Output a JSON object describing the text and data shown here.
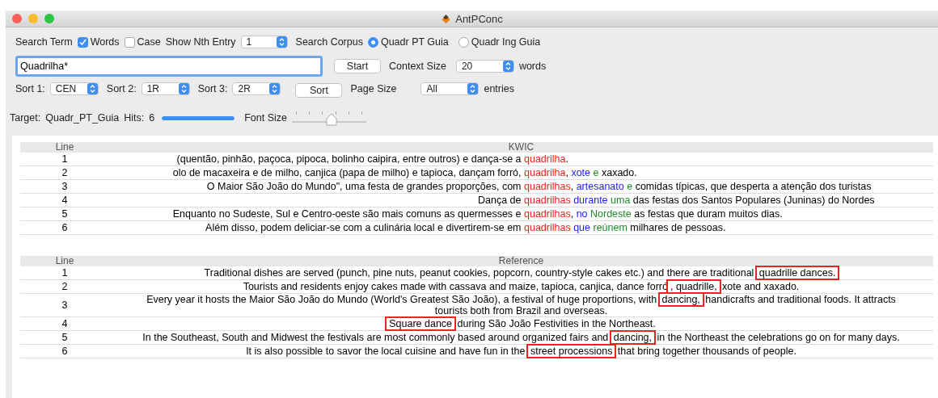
{
  "window": {
    "title": "AntPConc"
  },
  "search": {
    "label": "Search Term",
    "options": [
      {
        "label": "Words",
        "checked": true
      },
      {
        "label": "Case",
        "checked": false
      }
    ],
    "nth_label": "Show Nth Entry",
    "nth_value": "1",
    "corpus_label": "Search Corpus",
    "corpora": [
      {
        "label": "Quadr PT Guia",
        "selected": true
      },
      {
        "label": "Quadr Ing Guia",
        "selected": false
      }
    ],
    "term": "Quadrilha*",
    "start": "Start",
    "context_label": "Context Size",
    "context_value": "20",
    "context_unit": "words"
  },
  "sort": {
    "keys": [
      {
        "label": "Sort 1:",
        "value": "CEN"
      },
      {
        "label": "Sort 2:",
        "value": "1R"
      },
      {
        "label": "Sort 3:",
        "value": "2R"
      }
    ],
    "button": "Sort",
    "page_label": "Page Size",
    "page_value": "All",
    "page_unit": "entries"
  },
  "status": {
    "target_label": "Target:",
    "target": "Quadr_PT_Guia",
    "hits_label": "Hits:",
    "hits": "6",
    "hits_bar": {
      "level": 1
    },
    "font_label": "Font Size",
    "font_slider": {
      "level": 0.53
    }
  },
  "tables": [
    {
      "kind": "kwic",
      "columns": [
        "Line",
        "KWIC"
      ],
      "rows": [
        {
          "line": "1",
          "left": "(quentão, pinhão, paçoca, pipoca, bolinho caipira, entre outros) e dança-se a ",
          "segments": [
            {
              "text": "quadrilha",
              "kind": "center"
            },
            {
              "text": ".",
              "kind": "plain"
            }
          ]
        },
        {
          "line": "2",
          "left": "olo de macaxeira e de milho, canjica (papa de milho) e tapioca, dançam forró, ",
          "segments": [
            {
              "text": "quadrilha",
              "kind": "center"
            },
            {
              "text": ", ",
              "kind": "plain"
            },
            {
              "text": "xote",
              "kind": "first"
            },
            {
              "text": " e",
              "kind": "second"
            },
            {
              "text": " xaxado.",
              "kind": "plain"
            }
          ]
        },
        {
          "line": "3",
          "left": "O Maior São João do Mundo\", uma festa de grandes proporções, com ",
          "segments": [
            {
              "text": "quadrilhas",
              "kind": "center"
            },
            {
              "text": ", ",
              "kind": "plain"
            },
            {
              "text": "artesanato",
              "kind": "first"
            },
            {
              "text": " e",
              "kind": "second"
            },
            {
              "text": " comidas típicas, que desperta a atenção dos turistas",
              "kind": "plain"
            }
          ]
        },
        {
          "line": "4",
          "left": "Dança de ",
          "segments": [
            {
              "text": "quadrilhas",
              "kind": "center"
            },
            {
              "text": " durante",
              "kind": "first"
            },
            {
              "text": " uma",
              "kind": "second"
            },
            {
              "text": " das festas dos Santos Populares (Juninas) do Nordes",
              "kind": "plain"
            }
          ]
        },
        {
          "line": "5",
          "left": "Enquanto no Sudeste, Sul e Centro-oeste são mais comuns as quermesses e ",
          "segments": [
            {
              "text": "quadrilhas",
              "kind": "center"
            },
            {
              "text": ", ",
              "kind": "plain"
            },
            {
              "text": "no",
              "kind": "first"
            },
            {
              "text": " Nordeste",
              "kind": "second"
            },
            {
              "text": " as festas que duram muitos dias.",
              "kind": "plain"
            }
          ]
        },
        {
          "line": "6",
          "left": "Além disso, podem deliciar-se com a culinária local e divertirem-se em ",
          "segments": [
            {
              "text": "quadrilhas",
              "kind": "center"
            },
            {
              "text": " que",
              "kind": "first"
            },
            {
              "text": " reúnem",
              "kind": "second"
            },
            {
              "text": " milhares de pessoas.",
              "kind": "plain"
            }
          ]
        }
      ]
    },
    {
      "kind": "reference",
      "columns": [
        "Line",
        "Reference"
      ],
      "rows": [
        {
          "line": "1",
          "segments": [
            {
              "text": "Traditional dishes are served (punch, pine nuts, peanut cookies, popcorn, country-style cakes etc.) and there are traditional ",
              "boxed": false
            },
            {
              "text": "quadrille dances.",
              "boxed": true
            }
          ]
        },
        {
          "line": "2",
          "segments": [
            {
              "text": "Tourists and residents enjoy cakes made with cassava and maize, tapioca, canjica, dance forró",
              "boxed": false
            },
            {
              "text": ", quadrille,",
              "boxed": true
            },
            {
              "text": " xote and xaxado.",
              "boxed": false
            }
          ]
        },
        {
          "line": "3",
          "segments": [
            {
              "text": "Every year it hosts the Maior São João do Mundo (World's Greatest São João), a festival of huge proportions, with ",
              "boxed": false
            },
            {
              "text": "dancing,",
              "boxed": true
            },
            {
              "text": " handicrafts and traditional foods. It attracts tourists both from Brazil and overseas.",
              "boxed": false
            }
          ]
        },
        {
          "line": "4",
          "segments": [
            {
              "text": "Square dance",
              "boxed": true
            },
            {
              "text": " during São João Festivities in the Northeast.",
              "boxed": false
            }
          ]
        },
        {
          "line": "5",
          "segments": [
            {
              "text": "In the Southeast, South and Midwest the festivals are most commonly based around organized fairs and ",
              "boxed": false
            },
            {
              "text": "dancing,",
              "boxed": true
            },
            {
              "text": " in the Northeast the celebrations go on for many days.",
              "boxed": false
            }
          ]
        },
        {
          "line": "6",
          "segments": [
            {
              "text": "It is also possible to savor the local cuisine and have fun in the ",
              "boxed": false
            },
            {
              "text": "street processions",
              "boxed": true
            },
            {
              "text": " that bring together thousands of people.",
              "boxed": false
            }
          ]
        }
      ]
    }
  ]
}
